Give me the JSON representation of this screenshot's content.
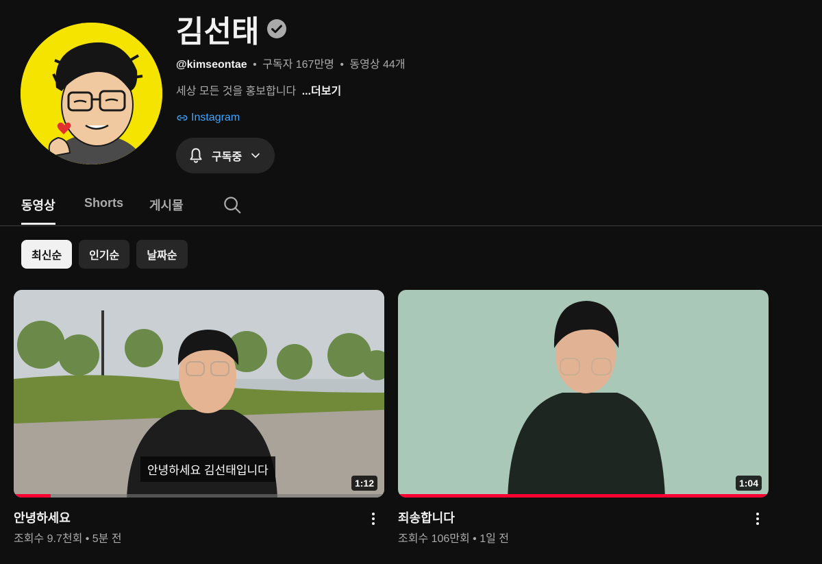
{
  "channel": {
    "name": "김선태",
    "handle": "@kimseontae",
    "subscribers": "구독자 167만명",
    "video_count": "동영상 44개",
    "separator": "•",
    "description": "세상 모든 것을 홍보합니다",
    "more_label": "...더보기",
    "link_label": "Instagram",
    "subscribe_label": "구독중"
  },
  "tabs": [
    {
      "label": "동영상",
      "active": true
    },
    {
      "label": "Shorts",
      "active": false
    },
    {
      "label": "게시물",
      "active": false
    }
  ],
  "chips": [
    {
      "label": "최신순",
      "selected": true
    },
    {
      "label": "인기순",
      "selected": false
    },
    {
      "label": "날짜순",
      "selected": false
    }
  ],
  "videos": [
    {
      "title": "안녕하세요",
      "meta": "조회수 9.7천회 • 5분 전",
      "duration": "1:12",
      "caption": "안녕하세요 김선태입니다",
      "progress": 0.1
    },
    {
      "title": "죄송합니다",
      "meta": "조회수 106만회 • 1일 전",
      "duration": "1:04",
      "progress": 1.0
    }
  ],
  "icons": {
    "verified": "verified-check-icon",
    "link": "link-icon",
    "bell": "bell-icon",
    "chevron": "chevron-down-icon",
    "search": "search-icon",
    "more": "more-vert-icon"
  },
  "colors": {
    "background": "#0f0f0f",
    "link": "#3ea6ff",
    "progress": "#ff0033",
    "avatar_bg": "#f5e400"
  }
}
